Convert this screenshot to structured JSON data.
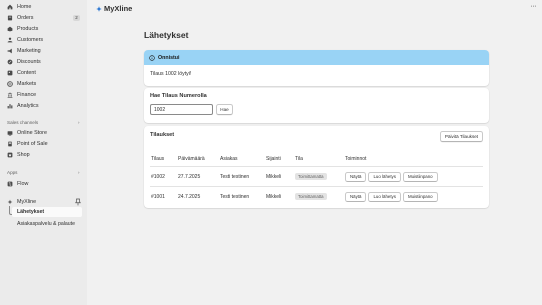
{
  "sidebar": {
    "items": [
      {
        "label": "Home",
        "icon": "home-icon"
      },
      {
        "label": "Orders",
        "icon": "orders-icon",
        "badge": "2"
      },
      {
        "label": "Products",
        "icon": "products-icon"
      },
      {
        "label": "Customers",
        "icon": "customers-icon"
      },
      {
        "label": "Marketing",
        "icon": "marketing-icon"
      },
      {
        "label": "Discounts",
        "icon": "discounts-icon"
      },
      {
        "label": "Content",
        "icon": "content-icon"
      },
      {
        "label": "Markets",
        "icon": "markets-icon"
      },
      {
        "label": "Finance",
        "icon": "finance-icon"
      },
      {
        "label": "Analytics",
        "icon": "analytics-icon"
      }
    ],
    "sales_channels_title": "Sales channels",
    "sales_channels": [
      {
        "label": "Online Store",
        "icon": "online-store-icon"
      },
      {
        "label": "Point of Sale",
        "icon": "point-of-sale-icon"
      },
      {
        "label": "Shop",
        "icon": "shop-icon"
      }
    ],
    "apps_title": "Apps",
    "apps": [
      {
        "label": "Flow",
        "icon": "flow-icon"
      }
    ],
    "app_name": "MyXline",
    "app_subitems": [
      {
        "label": "Lähetykset",
        "active": true
      },
      {
        "label": "Asiakaspalvelu & palaute",
        "active": false
      }
    ]
  },
  "header": {
    "app_title": "MyXline",
    "more_label": "···"
  },
  "page": {
    "title": "Lähetykset"
  },
  "banner": {
    "title": "Onnistui",
    "message": "Tilaus 1002 löytyi!",
    "color": "#99d3f5"
  },
  "search": {
    "title": "Hae Tilaus Numerolla",
    "value": "1002",
    "button": "Hae"
  },
  "orders": {
    "title": "Tilaukset",
    "refresh_button": "Päivitä Tilaukset",
    "columns": [
      "Tilaus",
      "Päivämäärä",
      "Asiakas",
      "Sijainti",
      "Tila",
      "Toiminnot"
    ],
    "rows": [
      {
        "order": "#1002",
        "date": "27.7.2025",
        "customer": "Testi testinen",
        "location": "Mikkeli",
        "status": "Toimittamatta"
      },
      {
        "order": "#1001",
        "date": "24.7.2025",
        "customer": "Testi testinen",
        "location": "Mikkeli",
        "status": "Toimittamatta"
      }
    ],
    "actions": [
      "Näytä",
      "Luo lähetys",
      "Muistiinpano"
    ]
  }
}
